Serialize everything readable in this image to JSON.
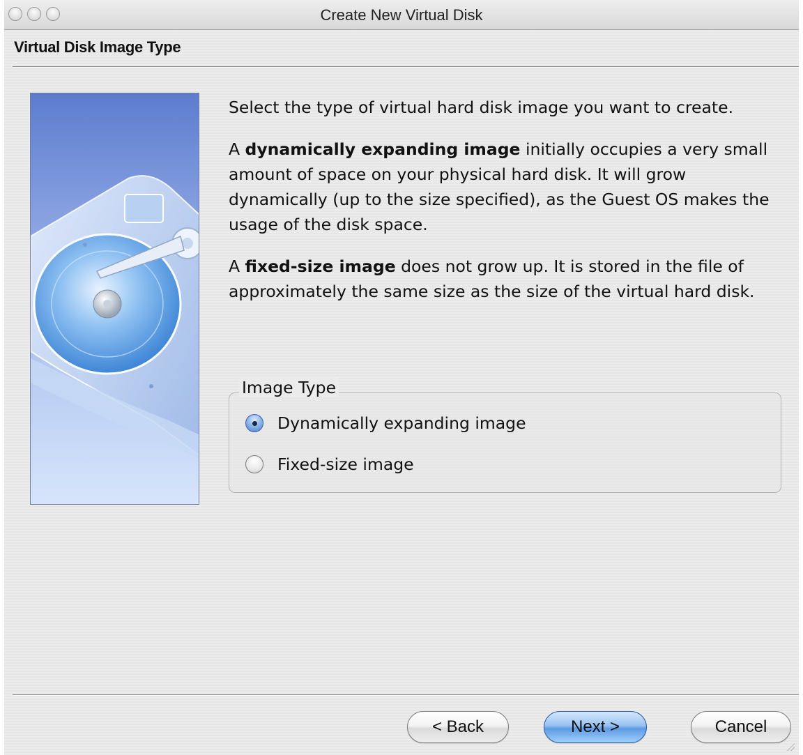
{
  "window": {
    "title": "Create New Virtual Disk"
  },
  "page": {
    "heading": "Virtual Disk Image Type"
  },
  "description": {
    "intro": "Select the type of virtual hard disk image you want to create.",
    "dynamic_prefix": "A ",
    "dynamic_term": "dynamically expanding image",
    "dynamic_rest": " initially occupies a very small amount of space on your physical hard disk. It will grow dynamically (up to the size specified), as the Guest OS makes the usage of the disk space.",
    "fixed_prefix": "A ",
    "fixed_term": "fixed-size image",
    "fixed_rest": " does not grow up. It is stored in the file of approximately the same size as the size of the virtual hard disk."
  },
  "image_type": {
    "group_label": "Image Type",
    "options": [
      {
        "label": "Dynamically expanding image",
        "selected": true
      },
      {
        "label": "Fixed-size image",
        "selected": false
      }
    ]
  },
  "buttons": {
    "back": "< Back",
    "next": "Next >",
    "cancel": "Cancel"
  },
  "colors": {
    "primary_button": "#5f9ae4",
    "illustration_top": "#5d7ccf",
    "illustration_bottom": "#d7e5fb"
  }
}
